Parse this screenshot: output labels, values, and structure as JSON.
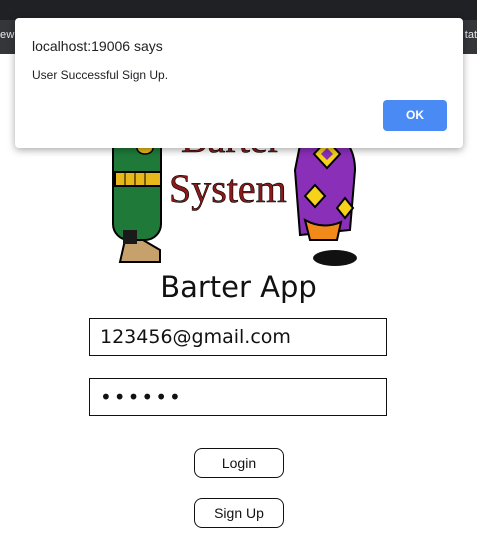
{
  "browser": {
    "left_fragment": "ewa",
    "right_fragment": "tat"
  },
  "alert": {
    "title": "localhost:19006 says",
    "message": "User Successful Sign Up.",
    "ok_label": "OK"
  },
  "logo": {
    "line1": "Barter",
    "line2": "System"
  },
  "app": {
    "title": "Barter App",
    "email_value": "123456@gmail.com",
    "password_value": "••••••",
    "login_label": "Login",
    "signup_label": "Sign Up"
  },
  "colors": {
    "ok_button": "#4a8af4",
    "logo_text": "#8b1a1a"
  }
}
